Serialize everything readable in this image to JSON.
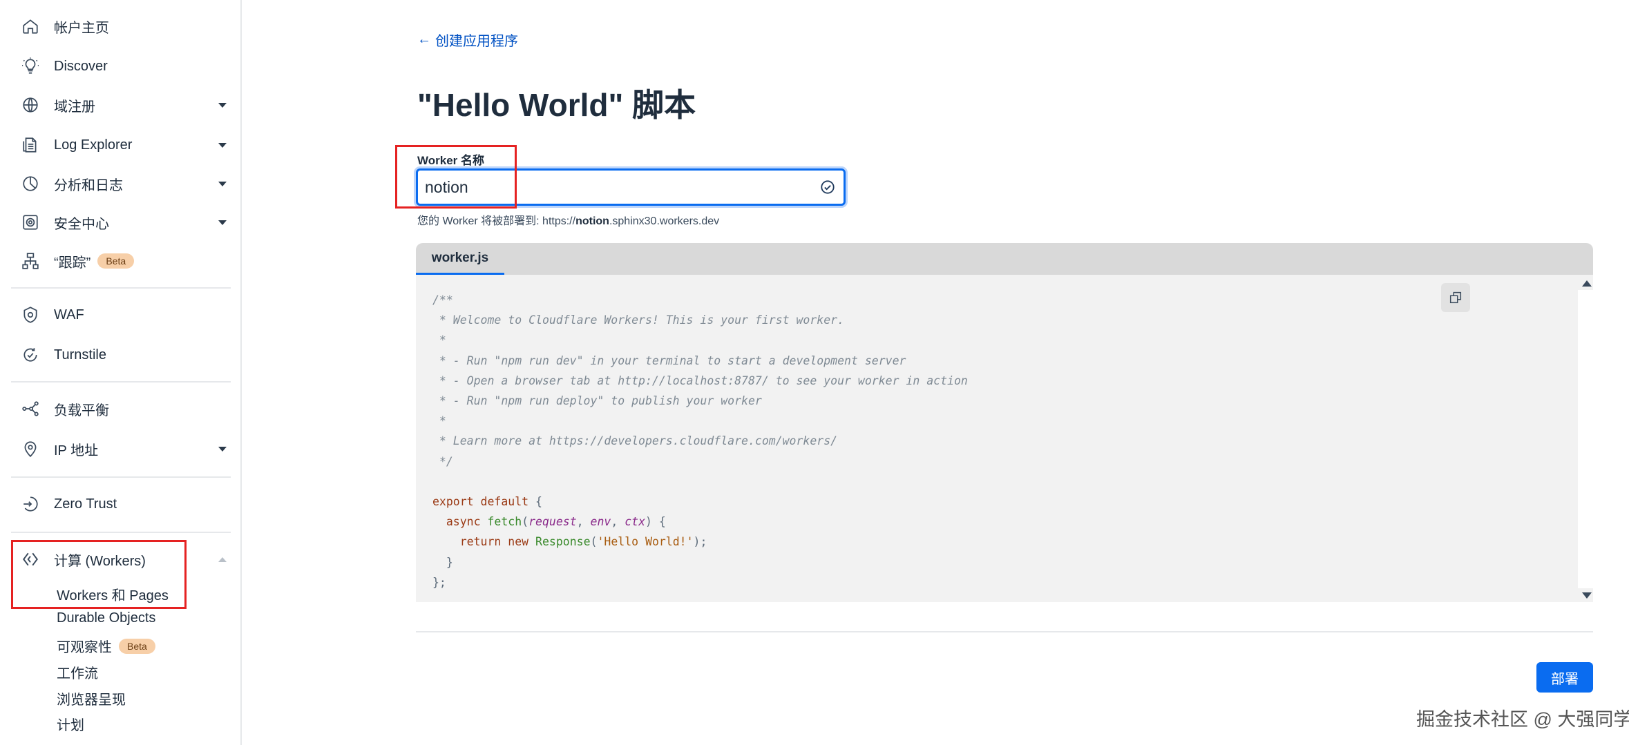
{
  "sidebar": {
    "items": [
      {
        "label": "帐户主页",
        "icon": "home-icon"
      },
      {
        "label": "Discover",
        "icon": "lightbulb-icon"
      },
      {
        "label": "域注册",
        "icon": "globe-icon"
      },
      {
        "label": "Log Explorer",
        "icon": "document-icon"
      },
      {
        "label": "分析和日志",
        "icon": "pie-chart-icon"
      },
      {
        "label": "安全中心",
        "icon": "security-center-icon"
      },
      {
        "label": "“跟踪”",
        "icon": "trace-icon",
        "badge": "Beta"
      },
      {
        "label": "WAF",
        "icon": "shield-icon"
      },
      {
        "label": "Turnstile",
        "icon": "turnstile-icon"
      },
      {
        "label": "负载平衡",
        "icon": "load-balancing-icon"
      },
      {
        "label": "IP 地址",
        "icon": "location-pin-icon"
      },
      {
        "label": "Zero Trust",
        "icon": "zero-trust-icon"
      },
      {
        "label": "计算 (Workers)",
        "icon": "workers-icon"
      }
    ],
    "sub_items": [
      {
        "label": "Workers 和 Pages"
      },
      {
        "label": "Durable Objects"
      },
      {
        "label": "可观察性",
        "badge": "Beta"
      },
      {
        "label": "工作流"
      },
      {
        "label": "浏览器呈现"
      },
      {
        "label": "计划"
      }
    ]
  },
  "main": {
    "back_link": "创建应用程序",
    "title": "\"Hello World\" 脚本",
    "worker_name_label": "Worker 名称",
    "worker_name_value": "notion",
    "deploy_note_prefix": "您的 Worker 将被部署到: https://",
    "deploy_note_name": "notion",
    "deploy_note_suffix": ".sphinx30.workers.dev",
    "editor_tab": "worker.js",
    "deploy_button": "部署"
  },
  "code": {
    "comment_lines": [
      "/**",
      " * Welcome to Cloudflare Workers! This is your first worker.",
      " *",
      " * - Run \"npm run dev\" in your terminal to start a development server",
      " * - Open a browser tab at http://localhost:8787/ to see your worker in action",
      " * - Run \"npm run deploy\" to publish your worker",
      " *",
      " * Learn more at https://developers.cloudflare.com/workers/",
      " */"
    ],
    "export": "export",
    "default": "default",
    "async": "async",
    "fetch": "fetch",
    "param_request": "request",
    "param_env": "env",
    "param_ctx": "ctx",
    "return": "return",
    "new": "new",
    "response_class": "Response",
    "hello_string": "'Hello World!'"
  },
  "watermark": "掘金技术社区 @ 大强同学",
  "colors": {
    "accent": "#0a6cf0",
    "highlight_box": "#e52222",
    "beta_badge": "#f7cfa8"
  }
}
